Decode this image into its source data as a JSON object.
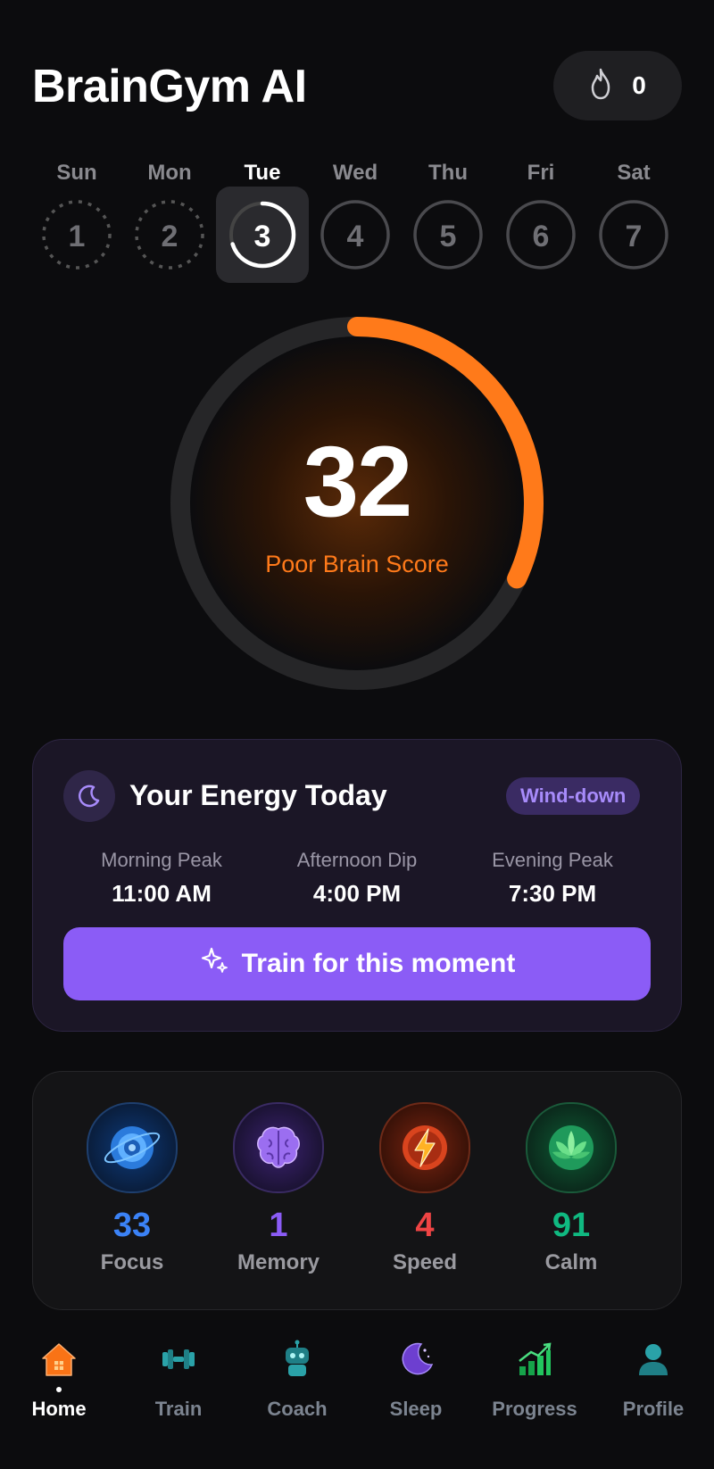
{
  "header": {
    "title": "BrainGym AI",
    "streak_count": "0",
    "streak_icon": "flame-icon"
  },
  "week": [
    {
      "name": "Sun",
      "num": "1",
      "state": "missed"
    },
    {
      "name": "Mon",
      "num": "2",
      "state": "missed"
    },
    {
      "name": "Tue",
      "num": "3",
      "state": "active",
      "progress": 0.7
    },
    {
      "name": "Wed",
      "num": "4",
      "state": "upcoming"
    },
    {
      "name": "Thu",
      "num": "5",
      "state": "upcoming"
    },
    {
      "name": "Fri",
      "num": "6",
      "state": "upcoming"
    },
    {
      "name": "Sat",
      "num": "7",
      "state": "upcoming"
    }
  ],
  "score": {
    "value": "32",
    "label": "Poor Brain Score",
    "progress": 0.32,
    "color": "#ff7a1a"
  },
  "energy": {
    "title": "Your Energy Today",
    "badge": "Wind-down",
    "icon": "moon-icon",
    "peaks": [
      {
        "label": "Morning Peak",
        "time": "11:00 AM"
      },
      {
        "label": "Afternoon Dip",
        "time": "4:00 PM"
      },
      {
        "label": "Evening Peak",
        "time": "7:30 PM"
      }
    ],
    "cta": "Train for this moment",
    "accent": "#8b5cf6"
  },
  "stats": [
    {
      "value": "33",
      "label": "Focus",
      "color": "#3b82f6",
      "icon": "target-icon"
    },
    {
      "value": "1",
      "label": "Memory",
      "color": "#8b5cf6",
      "icon": "brain-icon"
    },
    {
      "value": "4",
      "label": "Speed",
      "color": "#ef4444",
      "icon": "lightning-icon"
    },
    {
      "value": "91",
      "label": "Calm",
      "color": "#10b981",
      "icon": "lotus-icon"
    }
  ],
  "nav": [
    {
      "label": "Home",
      "icon": "home-icon",
      "active": true
    },
    {
      "label": "Train",
      "icon": "dumbbell-icon"
    },
    {
      "label": "Coach",
      "icon": "robot-icon"
    },
    {
      "label": "Sleep",
      "icon": "moon-icon"
    },
    {
      "label": "Progress",
      "icon": "chart-icon"
    },
    {
      "label": "Profile",
      "icon": "user-icon"
    }
  ]
}
